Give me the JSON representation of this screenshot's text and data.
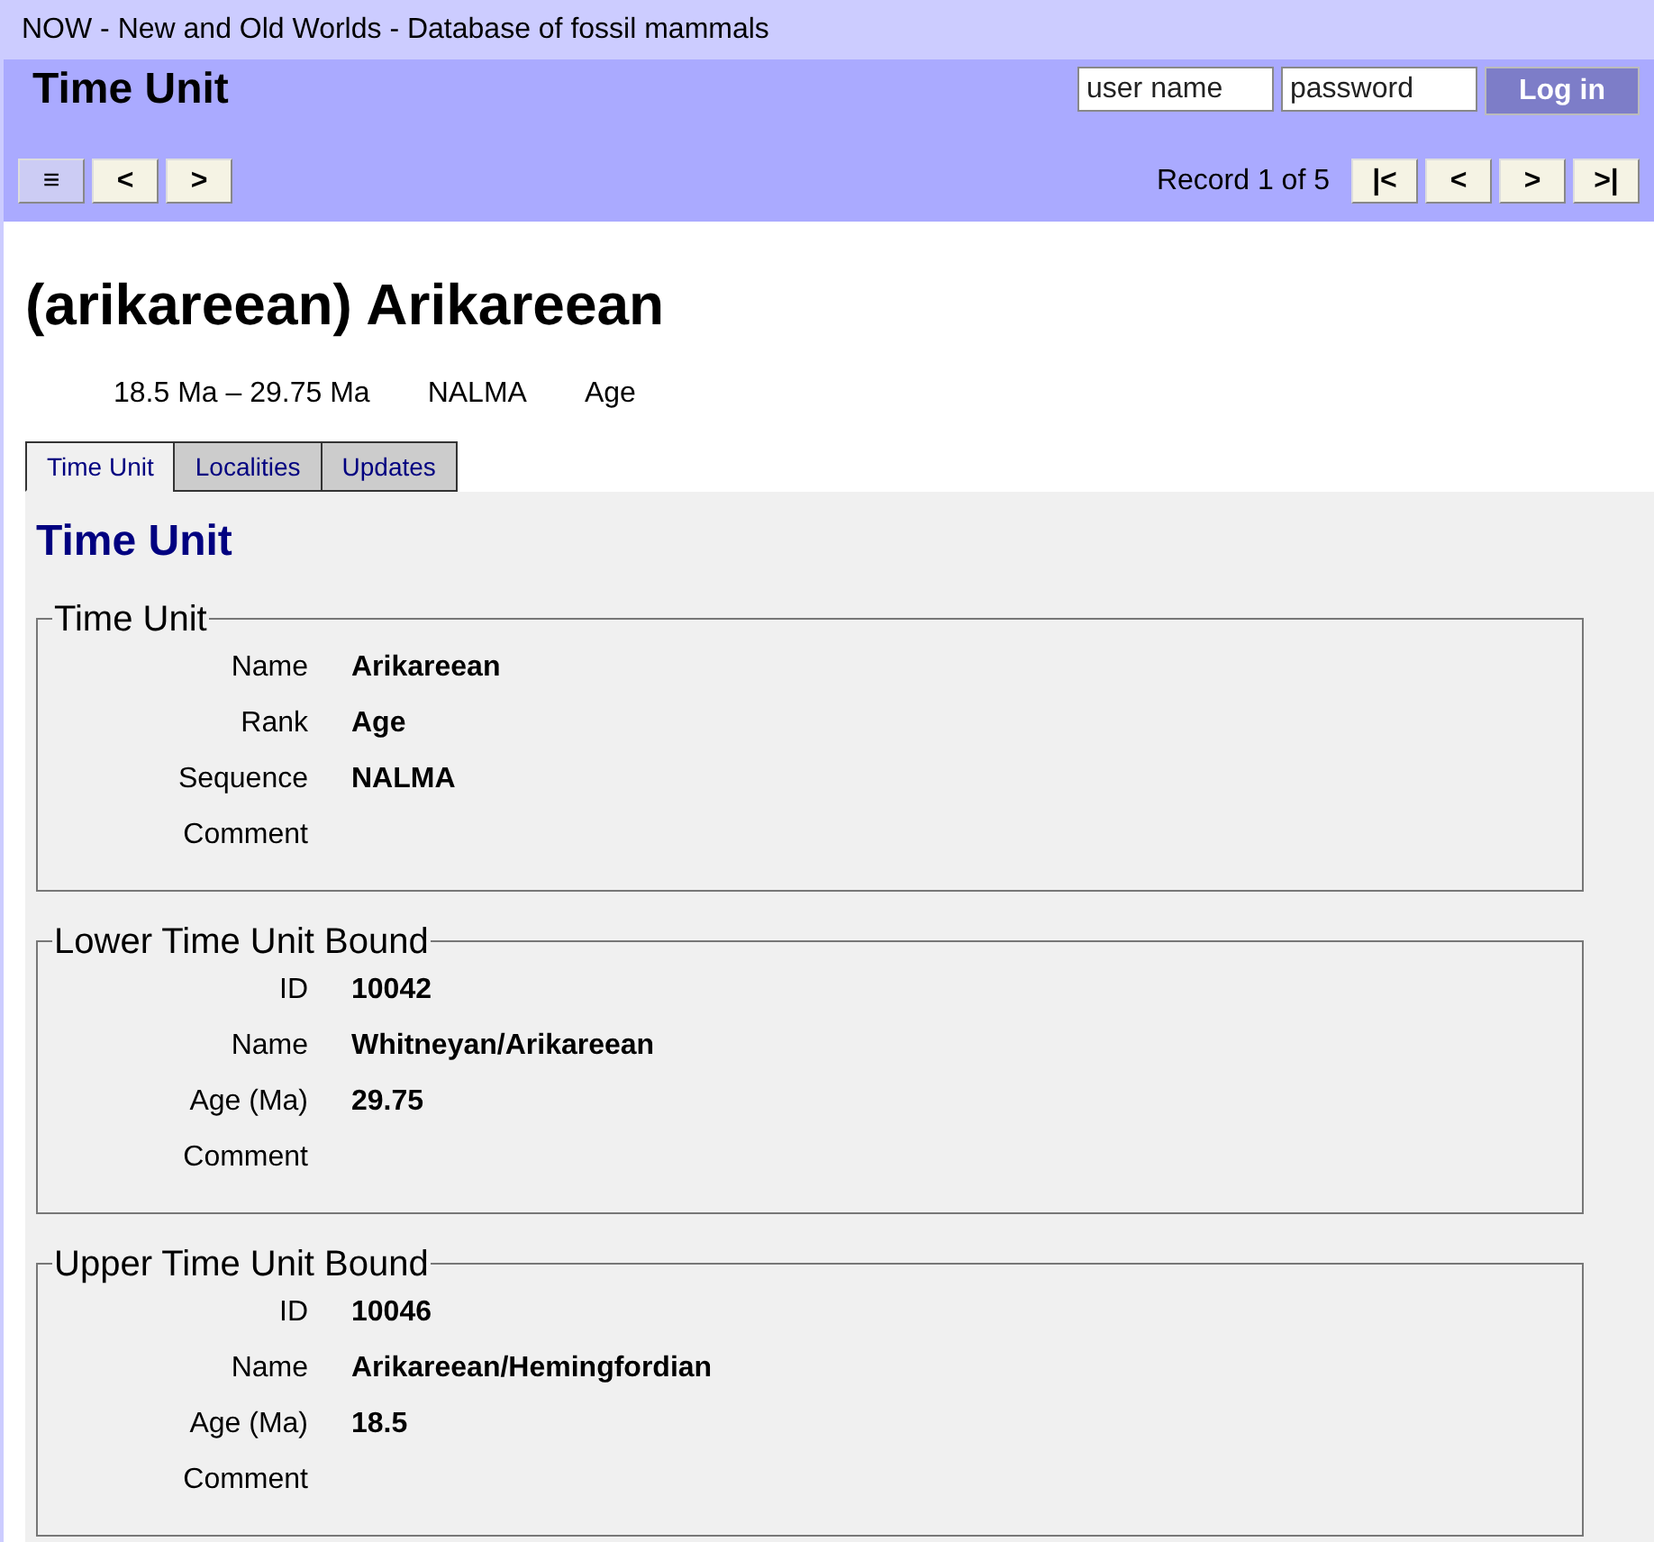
{
  "window": {
    "title": "NOW - New and Old Worlds - Database of fossil mammals"
  },
  "header": {
    "title": "Time Unit",
    "login": {
      "username_placeholder": "user name",
      "password_placeholder": "password",
      "button": "Log in",
      "button_disabled": true
    }
  },
  "toolbar": {
    "left_buttons": [
      {
        "label": "≡",
        "kind": "menu"
      },
      {
        "label": "<",
        "kind": "nav"
      },
      {
        "label": ">",
        "kind": "nav"
      }
    ],
    "record": "Record 1 of 5",
    "right_buttons": [
      "|<",
      "<",
      ">",
      ">|"
    ]
  },
  "record": {
    "title": "(arikareean) Arikareean",
    "summary": [
      "18.5 Ma – 29.75 Ma",
      "NALMA",
      "Age"
    ]
  },
  "tabs": [
    {
      "label": "Time Unit",
      "selected": true
    },
    {
      "label": "Localities",
      "selected": false
    },
    {
      "label": "Updates",
      "selected": false
    }
  ],
  "panel": {
    "heading": "Time Unit",
    "sections": [
      {
        "legend": "Time Unit",
        "fields": [
          {
            "label": "Name",
            "value": "Arikareean"
          },
          {
            "label": "Rank",
            "value": "Age"
          },
          {
            "label": "Sequence",
            "value": "NALMA"
          },
          {
            "label": "Comment"
          }
        ]
      },
      {
        "legend": "Lower Time Unit Bound",
        "fields": [
          {
            "label": "ID",
            "value": "10042"
          },
          {
            "label": "Name",
            "value": "Whitneyan/Arikareean"
          },
          {
            "label": "Age (Ma)",
            "value": "29.75"
          },
          {
            "label": "Comment"
          }
        ]
      },
      {
        "legend": "Upper Time Unit Bound",
        "fields": [
          {
            "label": "ID",
            "value": "10046"
          },
          {
            "label": "Name",
            "value": "Arikareean/Hemingfordian"
          },
          {
            "label": "Age (Ma)",
            "value": "18.5"
          },
          {
            "label": "Comment"
          }
        ]
      }
    ]
  }
}
